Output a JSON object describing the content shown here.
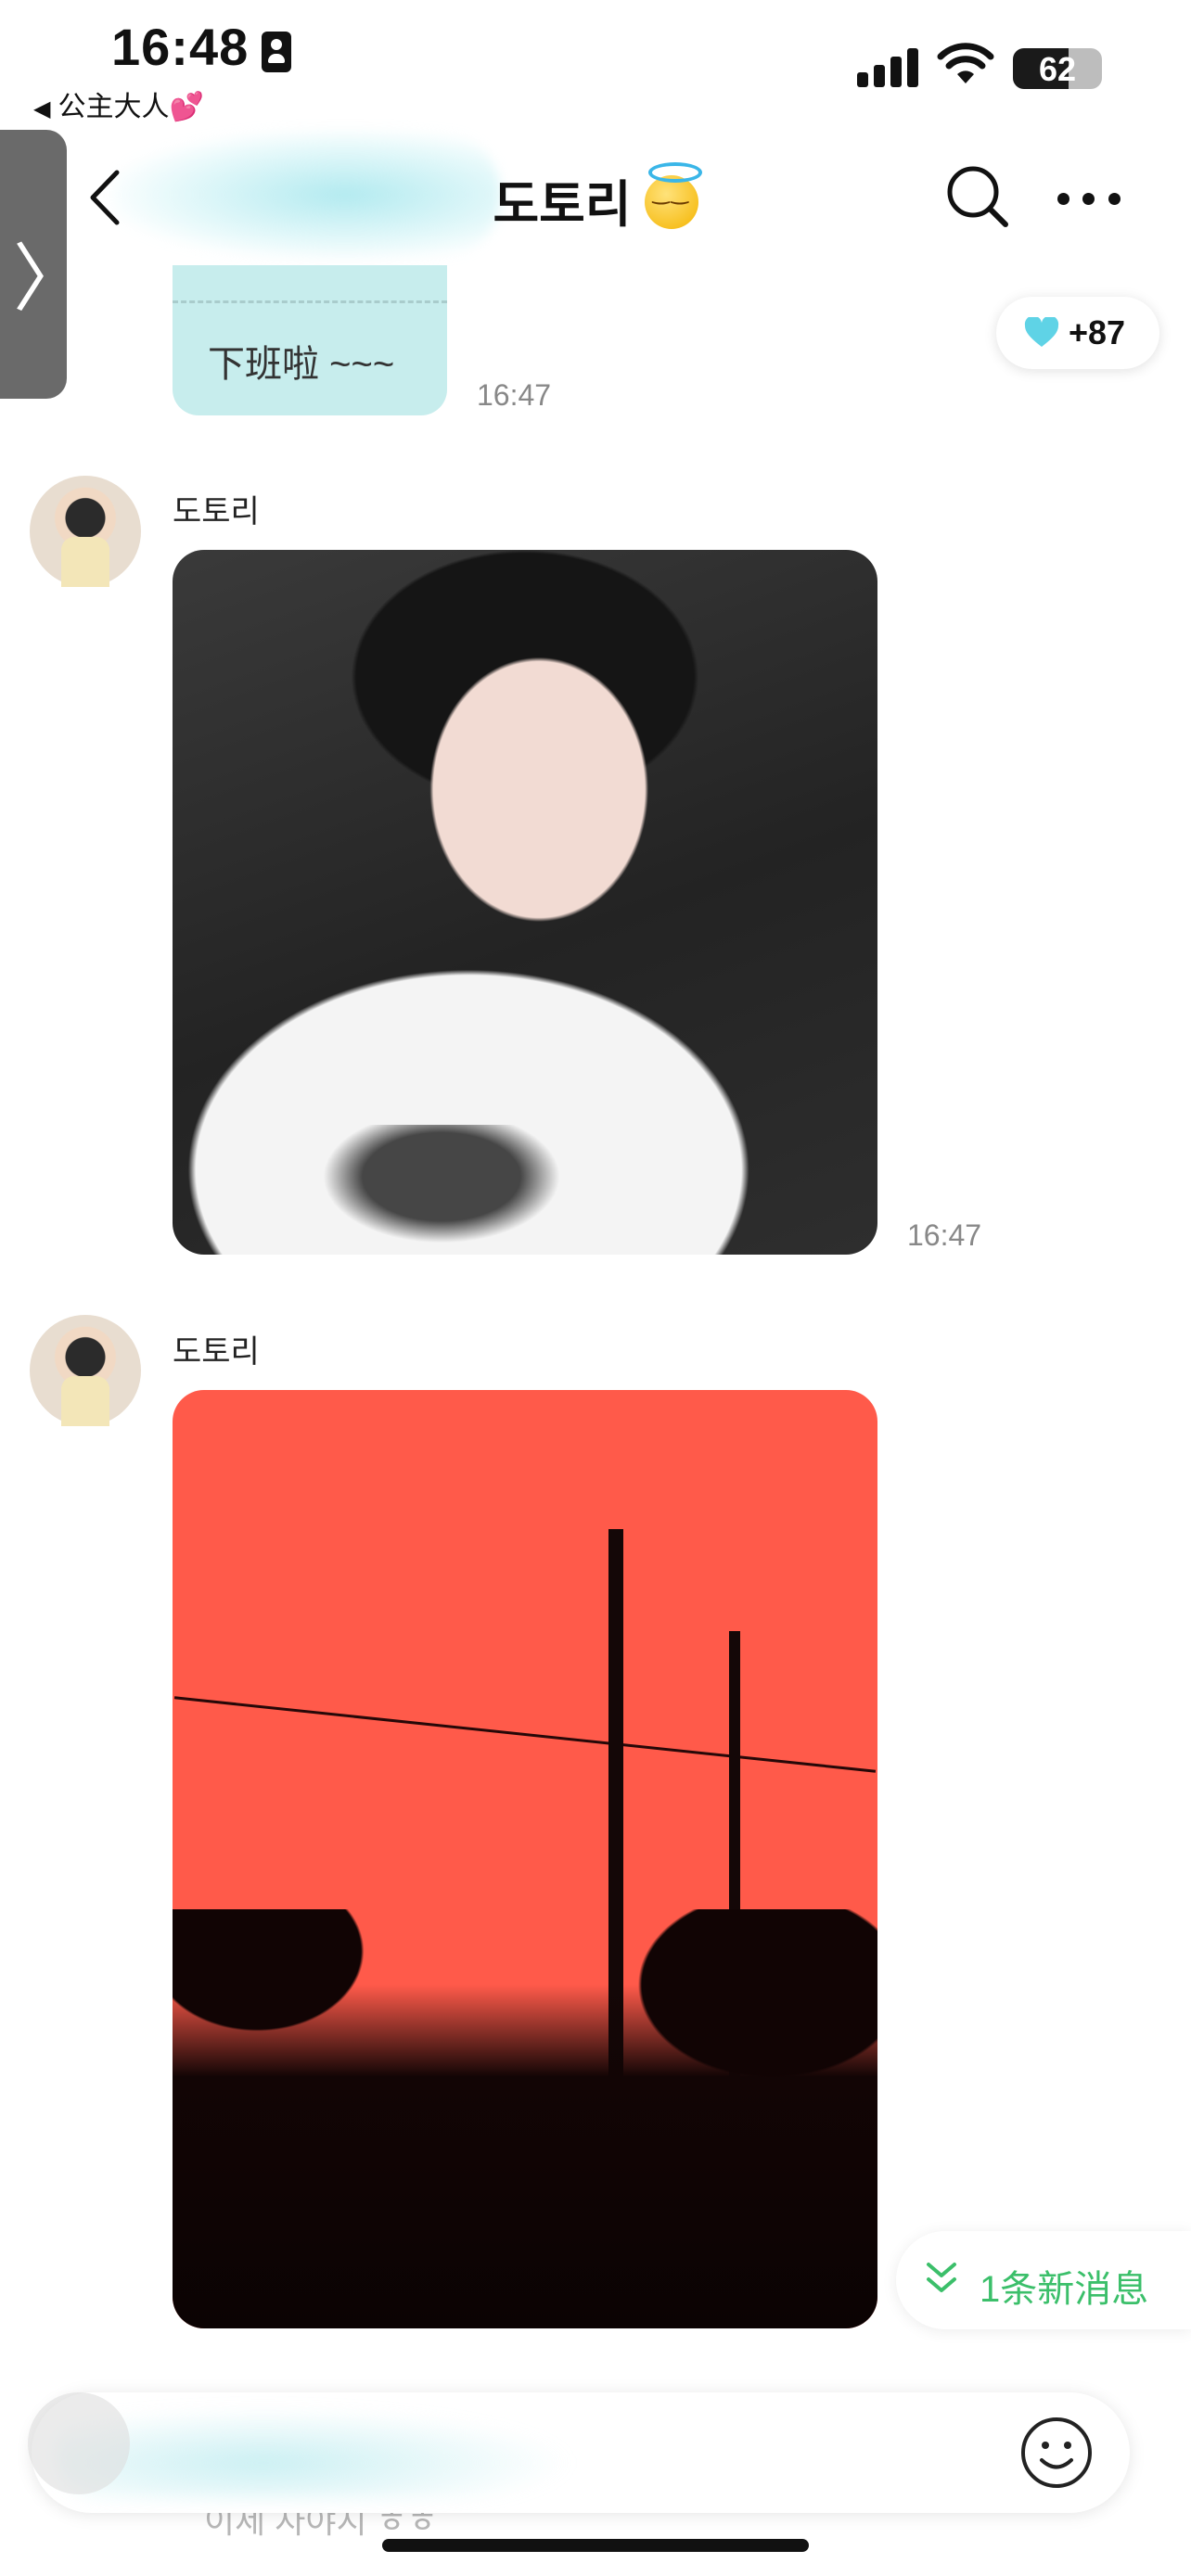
{
  "status_bar": {
    "time": "16:48",
    "back_app": "公主大人💕",
    "battery": "62"
  },
  "nav": {
    "title": "도토리"
  },
  "messages": [
    {
      "type": "text",
      "text": "下班啦 ~~~",
      "time": "16:47"
    },
    {
      "type": "image",
      "sender": "도토리",
      "time": "16:47",
      "image": "selfie-photo"
    },
    {
      "type": "image",
      "sender": "도토리",
      "image": "red-sunset-photo"
    }
  ],
  "reaction": {
    "count": "+87",
    "icon": "heart-icon",
    "color": "#5fd3e6"
  },
  "new_message": "1条新消息",
  "input": {
    "peek_text": "이제 자야지 ㅎㅎ"
  },
  "colors": {
    "bubble": "#c7eded",
    "accent_green": "#3bbf6a",
    "time_gray": "#888888"
  }
}
